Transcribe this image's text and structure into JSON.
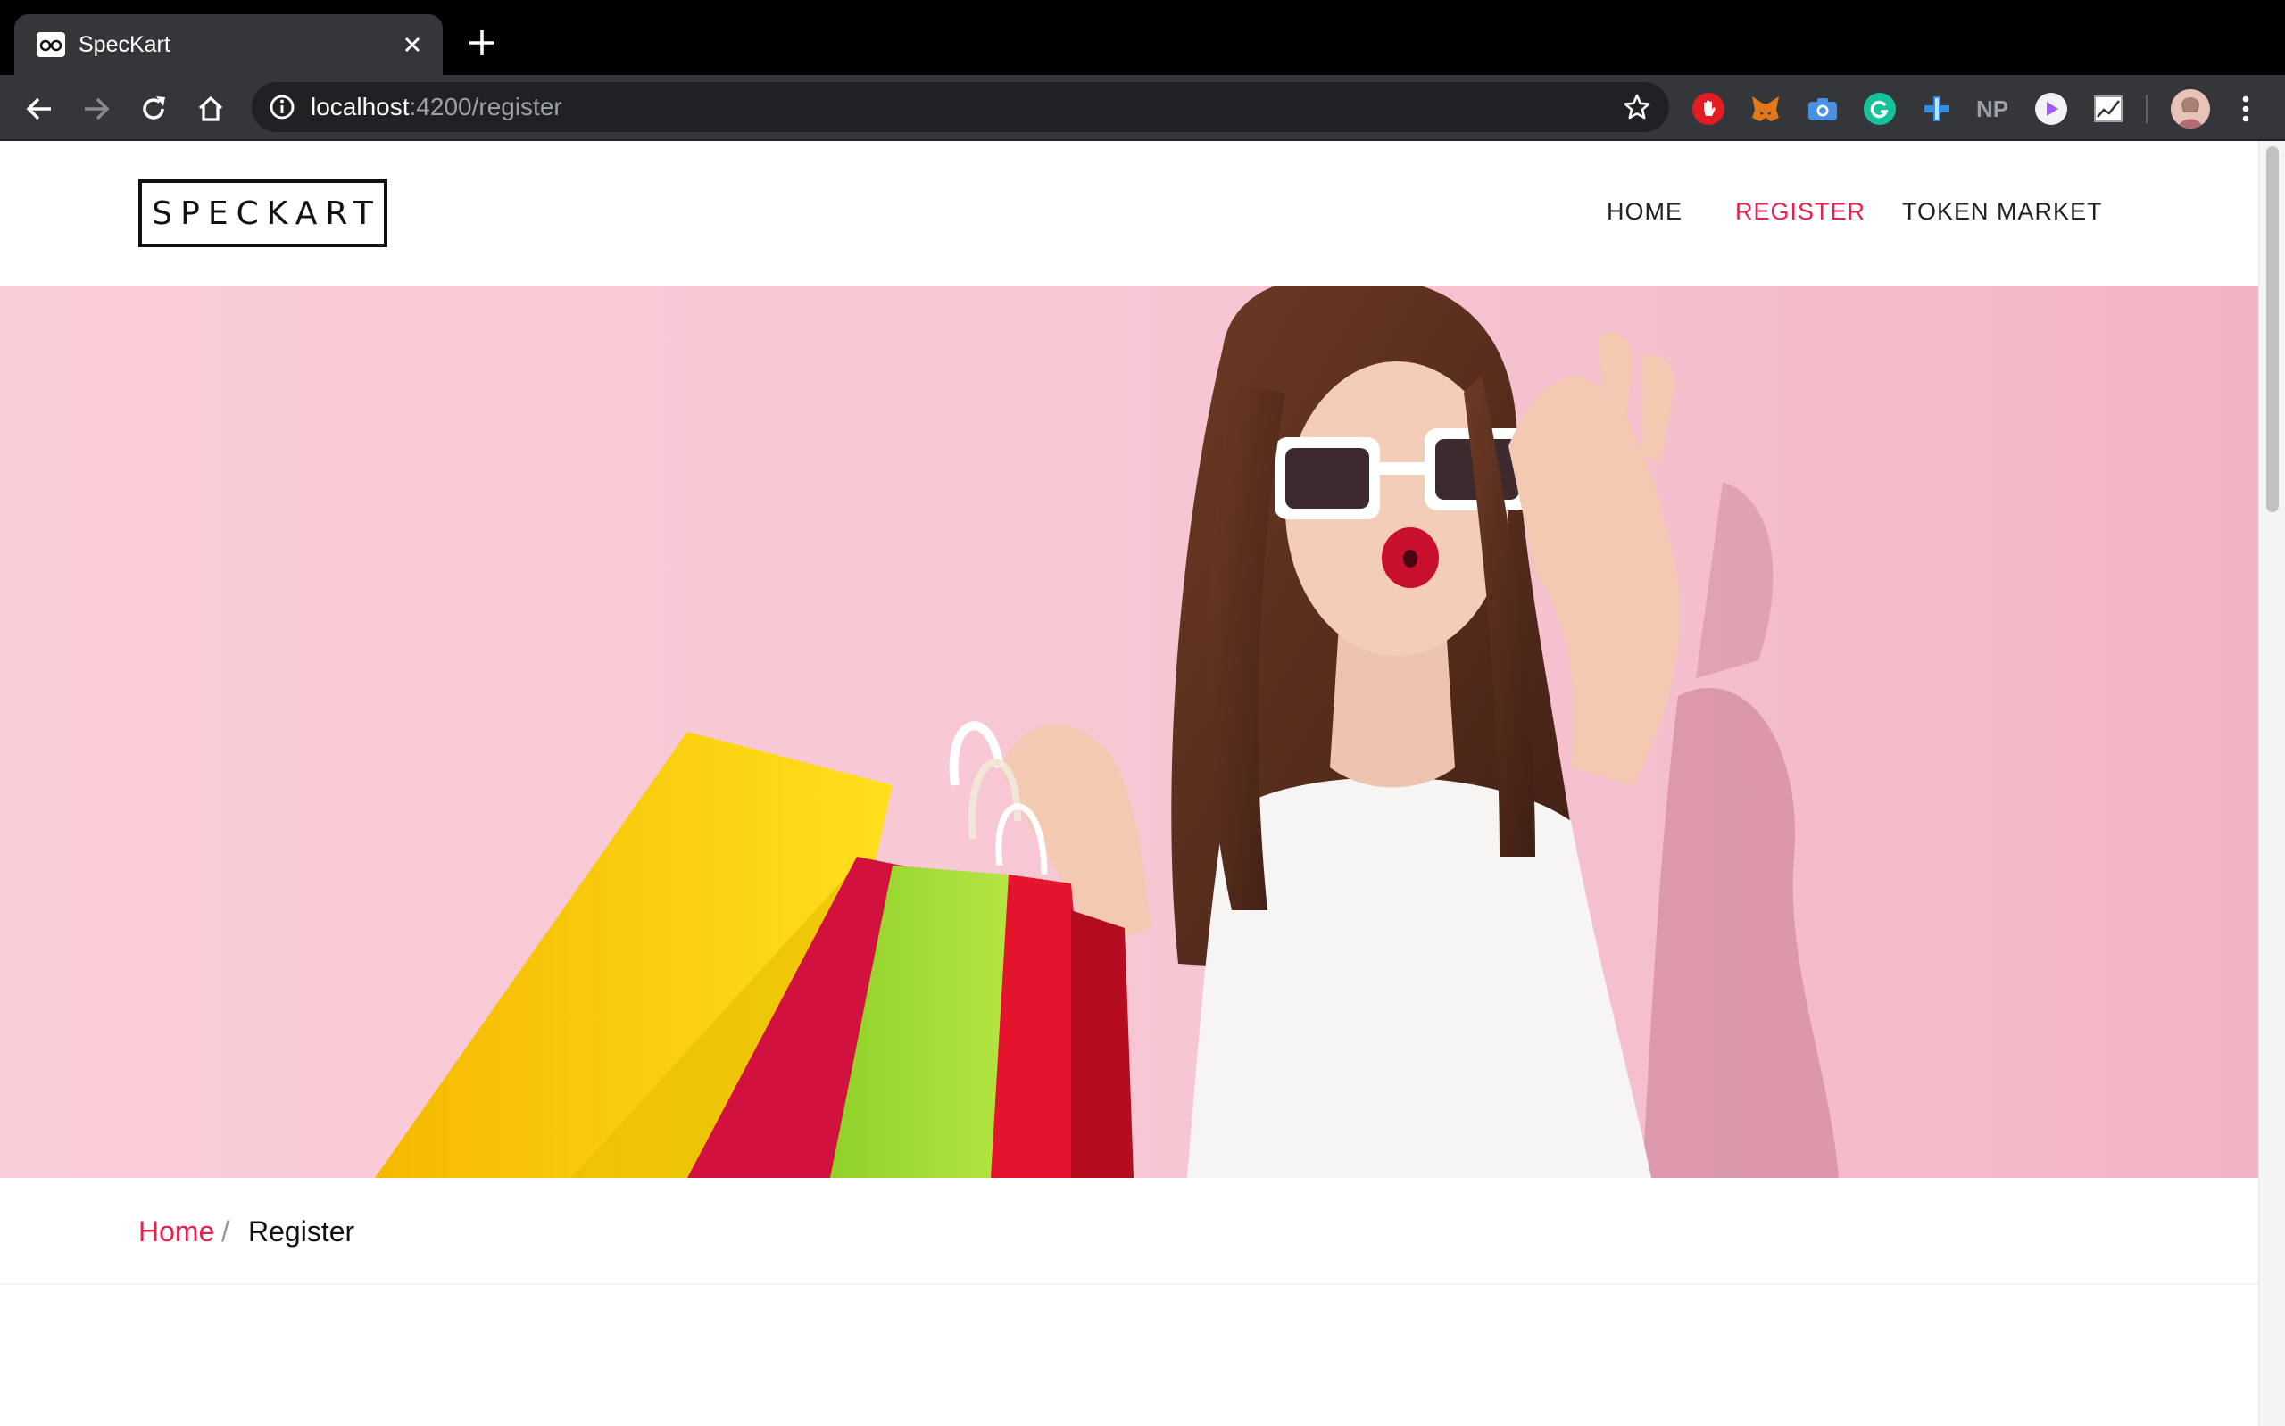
{
  "browser": {
    "tab_title": "SpecKart",
    "url_host": "localhost",
    "url_path": ":4200/register",
    "extensions": [
      "adblock-icon",
      "metamask-icon",
      "camera-icon",
      "grammarly-icon",
      "plus-extension-icon",
      "np-icon",
      "play-icon",
      "chart-extension-icon"
    ],
    "ext_np_label": "NP"
  },
  "site": {
    "logo": "SPECKART",
    "nav": {
      "home": "HOME",
      "register": "REGISTER",
      "token_market": "TOKEN MARKET"
    },
    "accent_color": "#e5224d"
  },
  "breadcrumb": {
    "home": "Home",
    "separator": "/",
    "current": "Register"
  }
}
